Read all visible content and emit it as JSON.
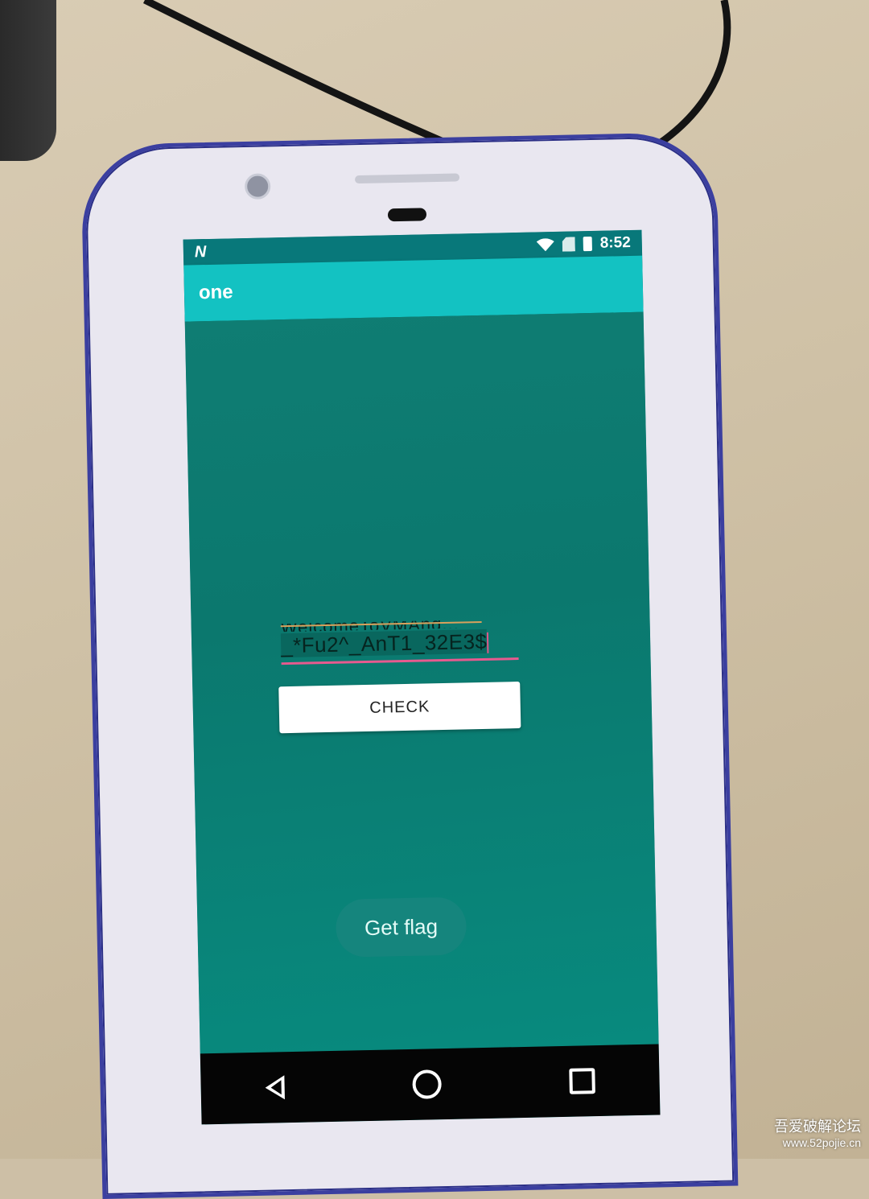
{
  "status_bar": {
    "left_icon": "n-notification-icon",
    "time": "8:52",
    "icons": [
      "wifi-icon",
      "no-sim-icon",
      "battery-icon"
    ]
  },
  "app_bar": {
    "title": "one"
  },
  "input": {
    "hidden_line_text": "WelcomeToVMAnd...",
    "value_visible": "_*Fu2^_AnT1_32E3$"
  },
  "buttons": {
    "check_label": "CHECK",
    "get_flag_label": "Get flag"
  },
  "nav_bar": {
    "icons": [
      "back-icon",
      "home-icon",
      "recents-icon"
    ]
  },
  "watermark": {
    "title": "吾爱破解论坛",
    "url": "www.52pojie.cn"
  }
}
